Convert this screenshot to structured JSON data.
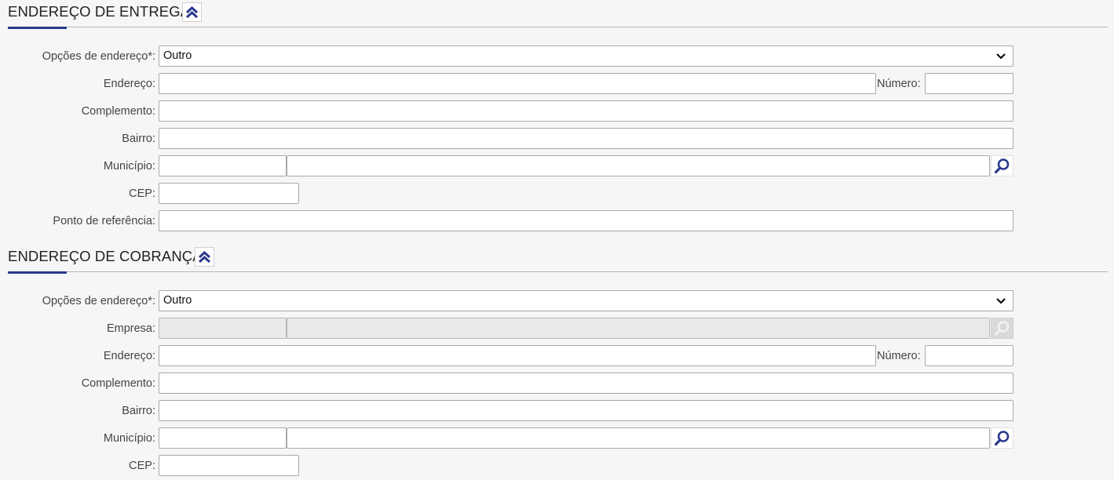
{
  "colors": {
    "accent": "#2b3a8c",
    "background": "#f6f6f6",
    "disabled_field": "#eaeaea"
  },
  "delivery": {
    "title": "ENDEREÇO DE ENTREGA",
    "collapse_icon": "double-chevron-up-icon",
    "labels": {
      "address_options": "Opções de endereço*:",
      "street": "Endereço:",
      "number": "Número:",
      "complement": "Complemento:",
      "district": "Bairro:",
      "city": "Município:",
      "zip": "CEP:",
      "reference": "Ponto de referência:"
    },
    "values": {
      "address_options": "Outro",
      "street": "",
      "number": "",
      "complement": "",
      "district": "",
      "city_code": "",
      "city_name": "",
      "zip": "",
      "reference": ""
    }
  },
  "billing": {
    "title": "ENDEREÇO DE COBRANÇA",
    "collapse_icon": "double-chevron-up-icon",
    "labels": {
      "address_options": "Opções de endereço*:",
      "company": "Empresa:",
      "street": "Endereço:",
      "number": "Número:",
      "complement": "Complemento:",
      "district": "Bairro:",
      "city": "Município:",
      "zip": "CEP:"
    },
    "values": {
      "address_options": "Outro",
      "company_code": "",
      "company_name": "",
      "street": "",
      "number": "",
      "complement": "",
      "district": "",
      "city_code": "",
      "city_name": "",
      "zip": ""
    }
  }
}
